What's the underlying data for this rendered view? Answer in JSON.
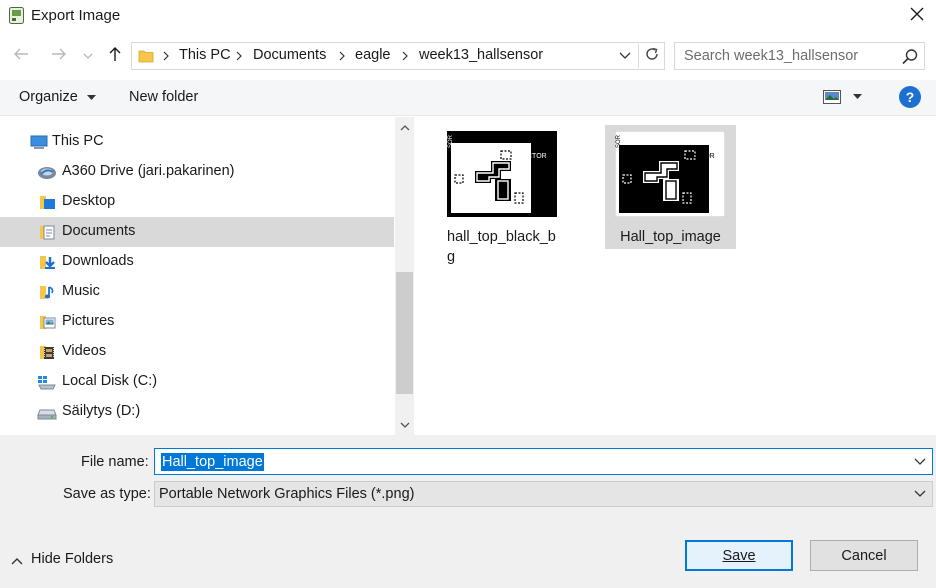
{
  "window": {
    "title": "Export Image",
    "icon": "eagle-app-icon",
    "close_icon": "close-icon"
  },
  "address": {
    "crumbs": [
      "This PC",
      "Documents",
      "eagle",
      "week13_hallsensor"
    ],
    "search_placeholder": "Search week13_hallsensor"
  },
  "toolbar": {
    "organize_label": "Organize",
    "new_folder_label": "New folder",
    "help_label": "?"
  },
  "sidebar": {
    "items": [
      {
        "label": "This PC",
        "icon": "computer-icon",
        "level": 0,
        "selected": false
      },
      {
        "label": "A360 Drive (jari.pakarinen)",
        "icon": "cloud-drive-icon",
        "level": 1,
        "selected": false
      },
      {
        "label": "Desktop",
        "icon": "desktop-folder-icon",
        "level": 1,
        "selected": false
      },
      {
        "label": "Documents",
        "icon": "documents-folder-icon",
        "level": 1,
        "selected": true
      },
      {
        "label": "Downloads",
        "icon": "downloads-folder-icon",
        "level": 1,
        "selected": false
      },
      {
        "label": "Music",
        "icon": "music-folder-icon",
        "level": 1,
        "selected": false
      },
      {
        "label": "Pictures",
        "icon": "pictures-folder-icon",
        "level": 1,
        "selected": false
      },
      {
        "label": "Videos",
        "icon": "videos-folder-icon",
        "level": 1,
        "selected": false
      },
      {
        "label": "Local Disk (C:)",
        "icon": "windows-drive-icon",
        "level": 1,
        "selected": false
      },
      {
        "label": "Säilytys (D:)",
        "icon": "drive-icon",
        "level": 1,
        "selected": false
      }
    ]
  },
  "files": [
    {
      "name": "hall_top_black_bg",
      "selected": false,
      "variant": "white-board-on-black"
    },
    {
      "name": "Hall_top_image",
      "selected": true,
      "variant": "black-board-on-white"
    }
  ],
  "save": {
    "file_name_label": "File name:",
    "file_name_value": "Hall_top_image",
    "type_label": "Save as type:",
    "type_value": "Portable Network Graphics Files (*.png)"
  },
  "footer": {
    "hide_folders_label": "Hide Folders",
    "save_label": "Save",
    "cancel_label": "Cancel"
  },
  "colors": {
    "accent": "#0078d7",
    "selection": "#d9d9d9",
    "help": "#1e6fd2"
  }
}
